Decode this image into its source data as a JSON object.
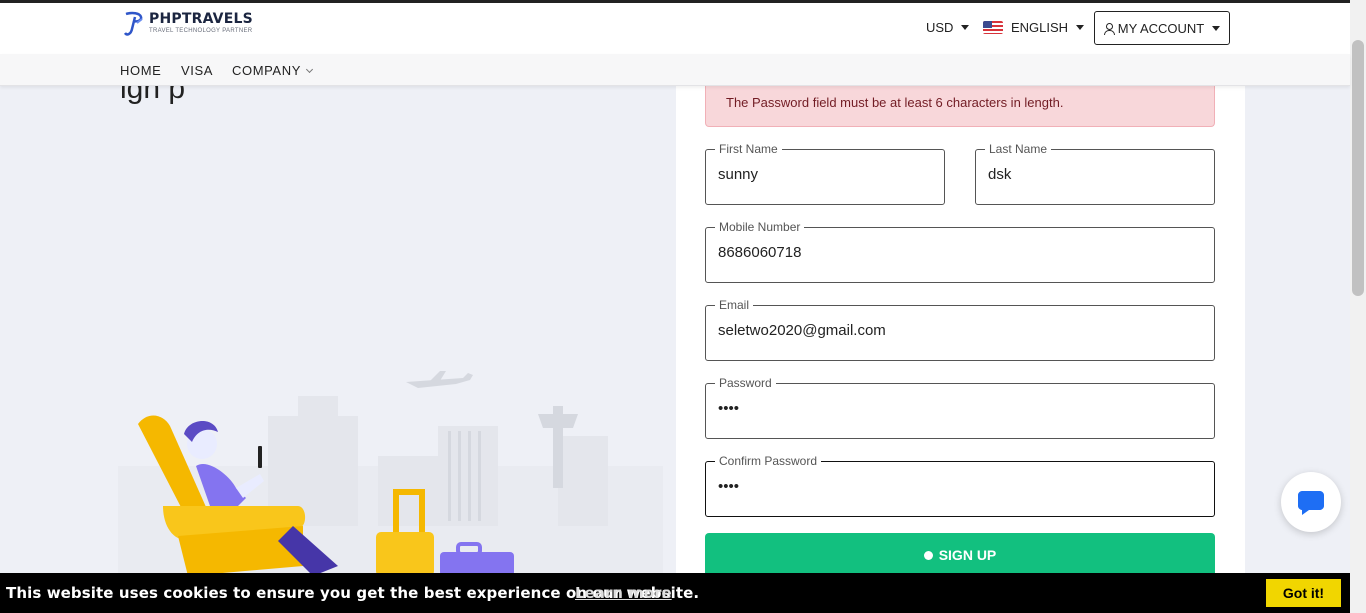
{
  "header": {
    "brand_name": "PHPTRAVELS",
    "brand_tagline": "TRAVEL TECHNOLOGY PARTNER",
    "currency": "USD",
    "language": "ENGLISH",
    "account_label": "MY ACCOUNT"
  },
  "nav": {
    "items": [
      {
        "label": "HOME"
      },
      {
        "label": "VISA"
      },
      {
        "label": "COMPANY"
      }
    ]
  },
  "page": {
    "title_fragment": "ign p"
  },
  "form": {
    "alert_text": "The Password field must be at least 6 characters in length.",
    "first_name": {
      "label": "First Name",
      "value": "sunny"
    },
    "last_name": {
      "label": "Last Name",
      "value": "dsk"
    },
    "mobile": {
      "label": "Mobile Number",
      "value": "8686060718"
    },
    "email": {
      "label": "Email",
      "value": "seletwo2020@gmail.com"
    },
    "password": {
      "label": "Password",
      "value": "••••"
    },
    "confirm_password": {
      "label": "Confirm Password",
      "value": "••••"
    },
    "submit_label": "SIGN UP"
  },
  "cookie": {
    "message": "This website uses cookies to ensure you get the best experience on our website.",
    "link": "Learn more",
    "button": "Got it!"
  },
  "colors": {
    "accent_green": "#12c07f",
    "alert_bg": "#f8d7da",
    "cookie_button": "#f1d600",
    "chat_blue": "#1e6ef4"
  },
  "icons": [
    "brand-logo-icon",
    "caret-down-icon",
    "us-flag-icon",
    "user-icon",
    "chevron-down-icon",
    "chat-icon"
  ]
}
